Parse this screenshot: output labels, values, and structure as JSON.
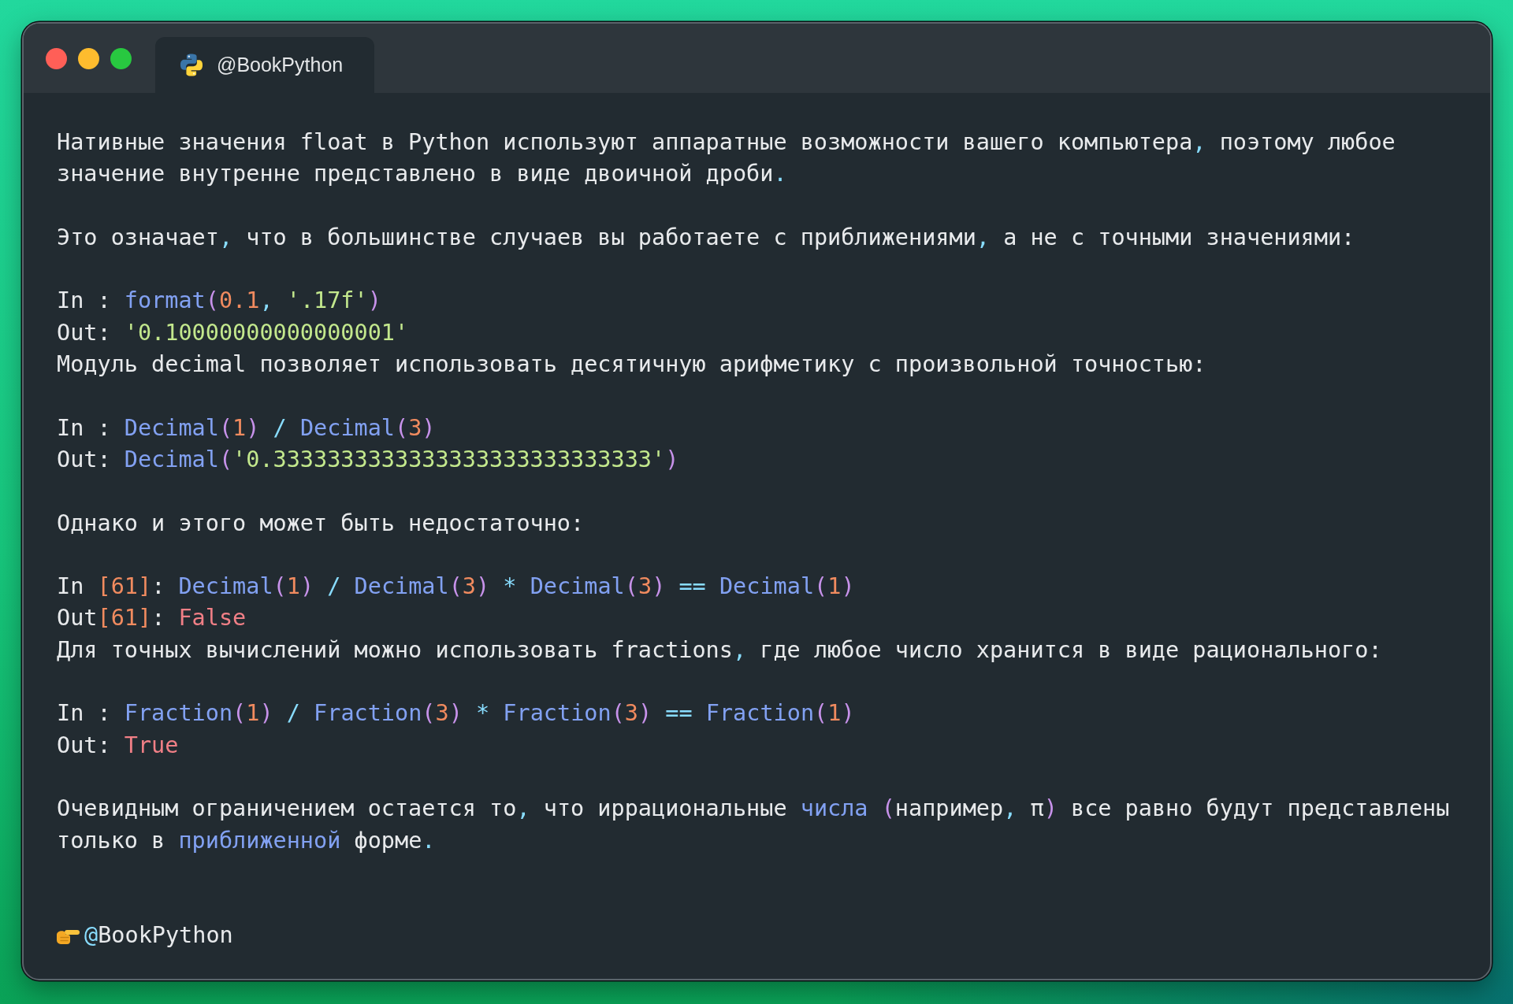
{
  "window": {
    "traffic_lights": [
      {
        "kind": "close"
      },
      {
        "kind": "minimize"
      },
      {
        "kind": "zoom"
      }
    ],
    "tab": {
      "title": "@BookPython",
      "selected": true
    }
  },
  "blocks": [
    [
      {
        "kind": "prose",
        "segments": [
          {
            "kind": "plain",
            "text": "Нативные значения float в Python используют аппаратные возможности вашего компьютера"
          },
          {
            "kind": "punct",
            "text": ","
          },
          {
            "kind": "plain",
            "text": " поэтому любое значение внутренне представлено в виде двоичной дроби"
          },
          {
            "kind": "punct",
            "text": "."
          }
        ]
      }
    ],
    [
      {
        "kind": "prose",
        "segments": [
          {
            "kind": "plain",
            "text": "Это означает"
          },
          {
            "kind": "punct",
            "text": ","
          },
          {
            "kind": "plain",
            "text": " что в большинстве случаев вы работаете с приближениями"
          },
          {
            "kind": "punct",
            "text": ","
          },
          {
            "kind": "plain",
            "text": " а не с точными значениями:"
          }
        ]
      }
    ],
    [
      {
        "kind": "input",
        "segments": [
          {
            "kind": "plain",
            "text": "In : "
          },
          {
            "kind": "name",
            "text": "format"
          },
          {
            "kind": "paren",
            "text": "("
          },
          {
            "kind": "number",
            "text": "0.1"
          },
          {
            "kind": "punct",
            "text": ","
          },
          {
            "kind": "string",
            "text": " '.17f'"
          },
          {
            "kind": "paren",
            "text": ")"
          }
        ]
      },
      {
        "kind": "output",
        "segments": [
          {
            "kind": "plain",
            "text": "Out: "
          },
          {
            "kind": "string",
            "text": "'0.10000000000000001'"
          }
        ]
      },
      {
        "kind": "prose",
        "segments": [
          {
            "kind": "plain",
            "text": "Модуль decimal позволяет использовать десятичную арифметику с произвольной точностью:"
          }
        ]
      }
    ],
    [
      {
        "kind": "input",
        "segments": [
          {
            "kind": "plain",
            "text": "In : "
          },
          {
            "kind": "name",
            "text": "Decimal"
          },
          {
            "kind": "paren",
            "text": "("
          },
          {
            "kind": "number",
            "text": "1"
          },
          {
            "kind": "paren",
            "text": ")"
          },
          {
            "kind": "punct",
            "text": " / "
          },
          {
            "kind": "name",
            "text": "Decimal"
          },
          {
            "kind": "paren",
            "text": "("
          },
          {
            "kind": "number",
            "text": "3"
          },
          {
            "kind": "paren",
            "text": ")"
          }
        ]
      },
      {
        "kind": "output",
        "segments": [
          {
            "kind": "plain",
            "text": "Out: "
          },
          {
            "kind": "name",
            "text": "Decimal"
          },
          {
            "kind": "paren",
            "text": "("
          },
          {
            "kind": "string",
            "text": "'0.3333333333333333333333333333'"
          },
          {
            "kind": "paren",
            "text": ")"
          }
        ]
      }
    ],
    [
      {
        "kind": "prose",
        "segments": [
          {
            "kind": "plain",
            "text": "Однако и этого может быть недостаточно:"
          }
        ]
      }
    ],
    [
      {
        "kind": "input",
        "segments": [
          {
            "kind": "plain",
            "text": "In "
          },
          {
            "kind": "number",
            "text": "[61]"
          },
          {
            "kind": "plain",
            "text": ": "
          },
          {
            "kind": "name",
            "text": "Decimal"
          },
          {
            "kind": "paren",
            "text": "("
          },
          {
            "kind": "number",
            "text": "1"
          },
          {
            "kind": "paren",
            "text": ")"
          },
          {
            "kind": "punct",
            "text": " / "
          },
          {
            "kind": "name",
            "text": "Decimal"
          },
          {
            "kind": "paren",
            "text": "("
          },
          {
            "kind": "number",
            "text": "3"
          },
          {
            "kind": "paren",
            "text": ")"
          },
          {
            "kind": "punct",
            "text": " * "
          },
          {
            "kind": "name",
            "text": "Decimal"
          },
          {
            "kind": "paren",
            "text": "("
          },
          {
            "kind": "number",
            "text": "3"
          },
          {
            "kind": "paren",
            "text": ")"
          },
          {
            "kind": "punct",
            "text": " == "
          },
          {
            "kind": "name",
            "text": "Decimal"
          },
          {
            "kind": "paren",
            "text": "("
          },
          {
            "kind": "number",
            "text": "1"
          },
          {
            "kind": "paren",
            "text": ")"
          }
        ]
      },
      {
        "kind": "output",
        "segments": [
          {
            "kind": "plain",
            "text": "Out"
          },
          {
            "kind": "number",
            "text": "[61]"
          },
          {
            "kind": "plain",
            "text": ": "
          },
          {
            "kind": "constant",
            "text": "False"
          }
        ]
      },
      {
        "kind": "prose",
        "segments": [
          {
            "kind": "plain",
            "text": "Для точных вычислений можно использовать fractions"
          },
          {
            "kind": "punct",
            "text": ","
          },
          {
            "kind": "plain",
            "text": " где любое число хранится в виде рационального:"
          }
        ]
      }
    ],
    [
      {
        "kind": "input",
        "segments": [
          {
            "kind": "plain",
            "text": "In : "
          },
          {
            "kind": "name",
            "text": "Fraction"
          },
          {
            "kind": "paren",
            "text": "("
          },
          {
            "kind": "number",
            "text": "1"
          },
          {
            "kind": "paren",
            "text": ")"
          },
          {
            "kind": "punct",
            "text": " / "
          },
          {
            "kind": "name",
            "text": "Fraction"
          },
          {
            "kind": "paren",
            "text": "("
          },
          {
            "kind": "number",
            "text": "3"
          },
          {
            "kind": "paren",
            "text": ")"
          },
          {
            "kind": "punct",
            "text": " * "
          },
          {
            "kind": "name",
            "text": "Fraction"
          },
          {
            "kind": "paren",
            "text": "("
          },
          {
            "kind": "number",
            "text": "3"
          },
          {
            "kind": "paren",
            "text": ")"
          },
          {
            "kind": "punct",
            "text": " == "
          },
          {
            "kind": "name",
            "text": "Fraction"
          },
          {
            "kind": "paren",
            "text": "("
          },
          {
            "kind": "number",
            "text": "1"
          },
          {
            "kind": "paren",
            "text": ")"
          }
        ]
      },
      {
        "kind": "output",
        "segments": [
          {
            "kind": "plain",
            "text": "Out: "
          },
          {
            "kind": "constant",
            "text": "True"
          }
        ]
      }
    ],
    [
      {
        "kind": "prose",
        "segments": [
          {
            "kind": "plain",
            "text": "Очевидным ограничением остается то"
          },
          {
            "kind": "punct",
            "text": ","
          },
          {
            "kind": "plain",
            "text": " что иррациональные "
          },
          {
            "kind": "name",
            "text": "числа"
          },
          {
            "kind": "paren",
            "text": " ("
          },
          {
            "kind": "plain",
            "text": "например"
          },
          {
            "kind": "punct",
            "text": ","
          },
          {
            "kind": "plain",
            "text": " π"
          },
          {
            "kind": "paren",
            "text": ")"
          },
          {
            "kind": "plain",
            "text": " все равно будут представлены только в "
          },
          {
            "kind": "name",
            "text": "приближенной"
          },
          {
            "kind": "plain",
            "text": " форме"
          },
          {
            "kind": "punct",
            "text": "."
          }
        ]
      }
    ]
  ],
  "footer": {
    "segments": [
      {
        "kind": "punct",
        "text": "@"
      },
      {
        "kind": "plain",
        "text": "BookPython"
      }
    ]
  }
}
